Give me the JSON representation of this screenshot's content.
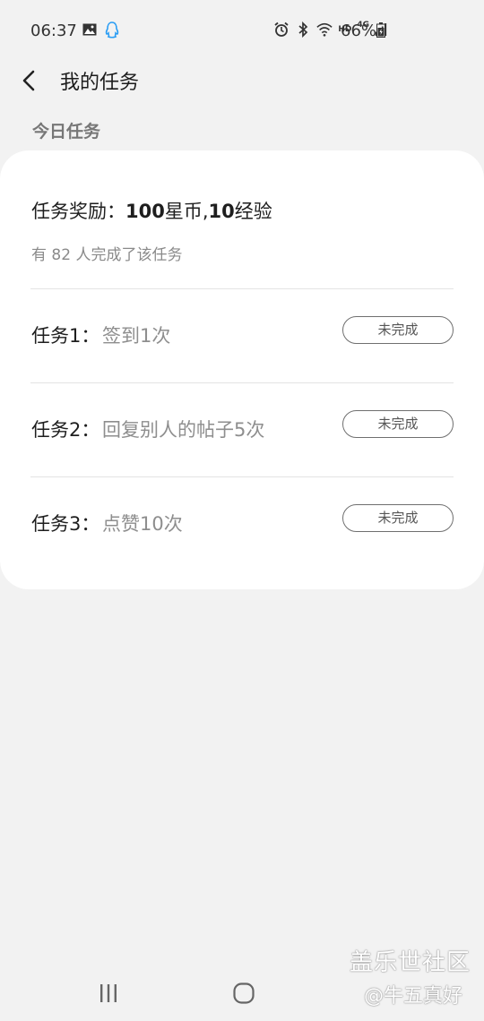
{
  "status_bar": {
    "time": "06:37",
    "hd": "HD",
    "network": "4G",
    "battery": "66%",
    "icons": [
      "image-icon",
      "qq-icon",
      "alarm-icon",
      "bluetooth-icon",
      "wifi-icon",
      "signal-icon",
      "battery-icon"
    ]
  },
  "header": {
    "title": "我的任务"
  },
  "section_title": "今日任务",
  "card": {
    "reward_prefix": "任务奖励：",
    "reward_coins": "100",
    "reward_coins_unit": "星币,",
    "reward_exp": "10",
    "reward_exp_unit": "经验",
    "completed_text": "有 82 人完成了该任务",
    "tasks": [
      {
        "label": "任务1：",
        "desc": "签到1次",
        "status": "未完成"
      },
      {
        "label": "任务2：",
        "desc": "回复别人的帖子5次",
        "status": "未完成"
      },
      {
        "label": "任务3：",
        "desc": "点赞10次",
        "status": "未完成"
      }
    ]
  },
  "watermark": {
    "line1": "盖乐世社区",
    "line2": "@牛五真好"
  },
  "colors": {
    "background": "#f2f2f2",
    "card": "#ffffff",
    "muted_text": "#8e8e8e"
  }
}
